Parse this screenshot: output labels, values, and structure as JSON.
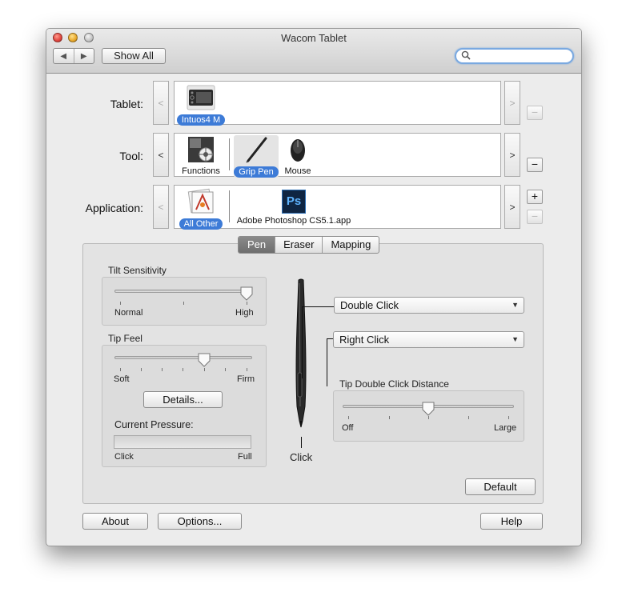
{
  "window": {
    "title": "Wacom Tablet"
  },
  "toolbar": {
    "back": "◀",
    "forward": "▶",
    "show_all": "Show All",
    "search_placeholder": ""
  },
  "rows": {
    "tablet": {
      "label": "Tablet:",
      "items": [
        {
          "name": "Intuos4 M",
          "selected": true
        }
      ]
    },
    "tool": {
      "label": "Tool:",
      "items": [
        {
          "name": "Functions",
          "selected": false
        },
        {
          "name": "Grip Pen",
          "selected": true
        },
        {
          "name": "Mouse",
          "selected": false
        }
      ]
    },
    "application": {
      "label": "Application:",
      "items": [
        {
          "name": "All Other",
          "selected": true
        },
        {
          "name": "Adobe Photoshop CS5.1.app",
          "selected": false
        }
      ],
      "ps_text": "Ps"
    }
  },
  "arrows": {
    "left": "<",
    "right": ">"
  },
  "buttons_pm": {
    "plus": "+",
    "minus": "−"
  },
  "tabs": [
    {
      "label": "Pen",
      "active": true
    },
    {
      "label": "Eraser",
      "active": false
    },
    {
      "label": "Mapping",
      "active": false
    }
  ],
  "pen": {
    "tilt": {
      "title": "Tilt Sensitivity",
      "min_label": "Normal",
      "max_label": "High",
      "value_fraction": 1.0
    },
    "tipfeel": {
      "title": "Tip Feel",
      "min_label": "Soft",
      "max_label": "Firm",
      "value_fraction": 0.6,
      "details_button": "Details..."
    },
    "pressure": {
      "title": "Current Pressure:",
      "min_label": "Click",
      "max_label": "Full",
      "value_fraction": 0.0
    },
    "upper_button": "Double Click",
    "lower_button": "Right Click",
    "tip_label": "Click",
    "double_click_distance": {
      "title": "Tip Double Click Distance",
      "min_label": "Off",
      "max_label": "Large",
      "value_fraction": 0.5
    },
    "default_button": "Default"
  },
  "footer": {
    "about": "About",
    "options": "Options...",
    "help": "Help"
  },
  "colors": {
    "accent": "#3d7bd7",
    "window_bg": "#ececec",
    "panel_bg": "#e3e3e3"
  }
}
